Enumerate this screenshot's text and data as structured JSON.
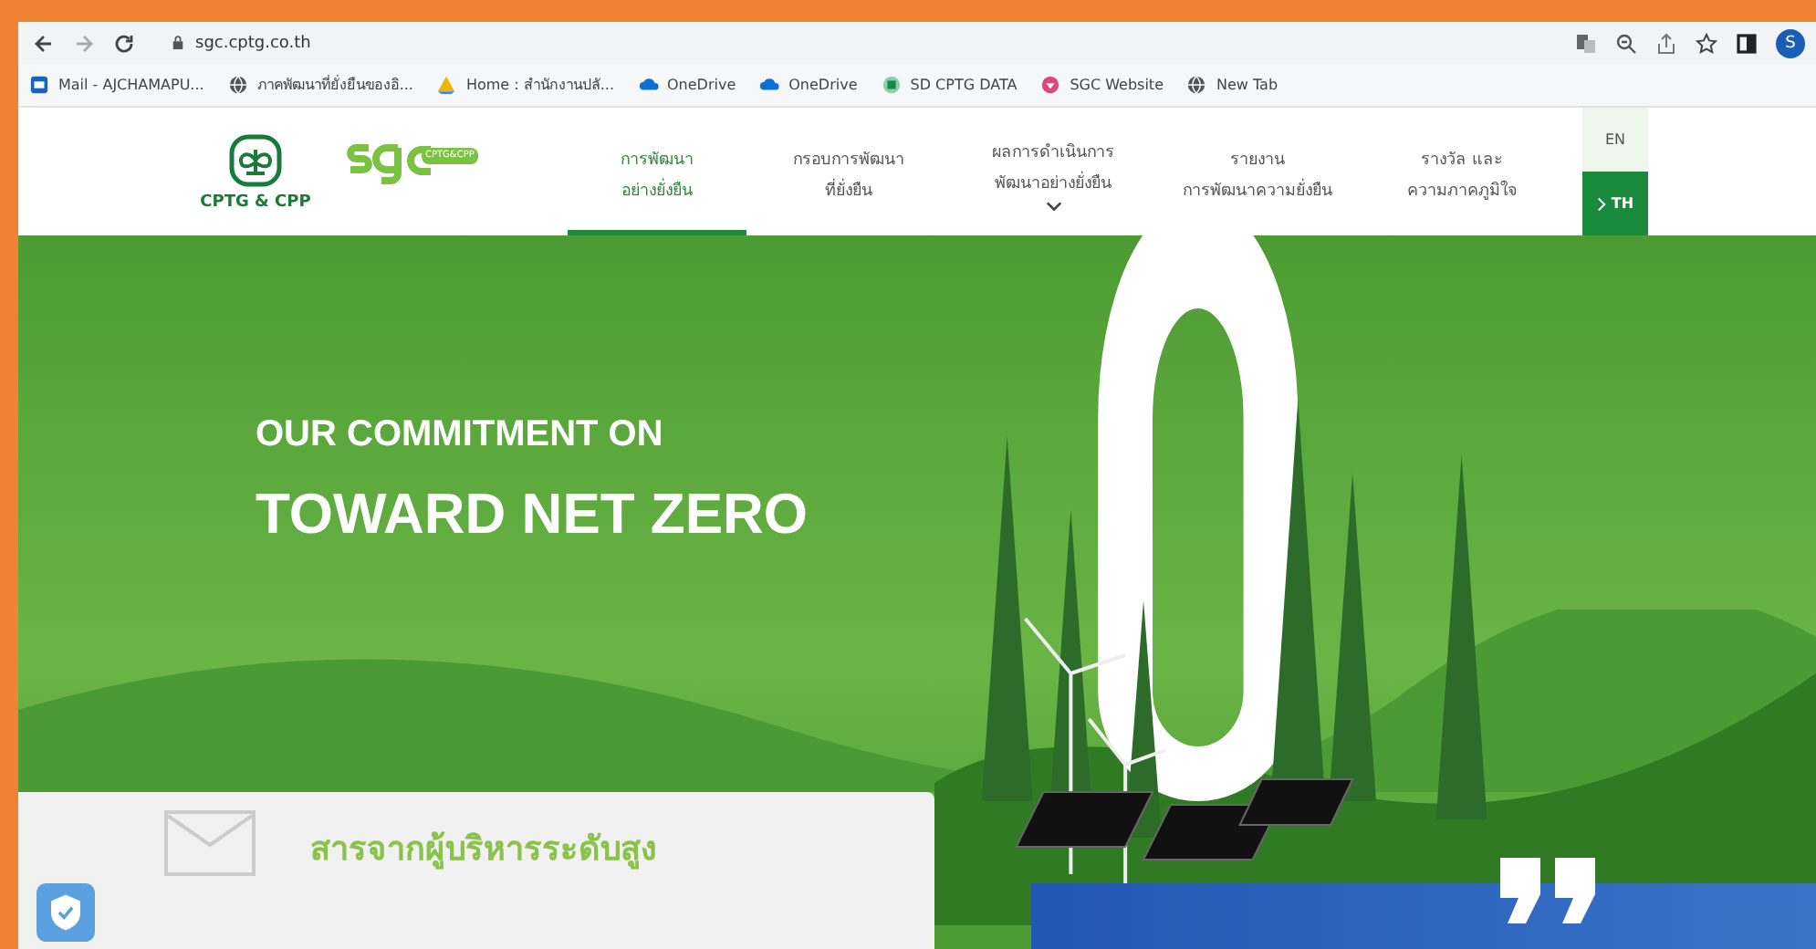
{
  "browser": {
    "url": "sgc.cptg.co.th",
    "avatar": "S",
    "bookmarks": [
      {
        "label": "Mail - AJCHAMAPU...",
        "kind": "mail"
      },
      {
        "label": "ภาคพัฒนาที่ยั่งยืนของอิ...",
        "kind": "globe"
      },
      {
        "label": "Home : สำนักงานปลั...",
        "kind": "drive"
      },
      {
        "label": "OneDrive",
        "kind": "cloud"
      },
      {
        "label": "OneDrive",
        "kind": "cloud"
      },
      {
        "label": "SD CPTG DATA",
        "kind": "sheet"
      },
      {
        "label": "SGC Website",
        "kind": "site"
      },
      {
        "label": "New Tab",
        "kind": "globe"
      }
    ]
  },
  "site": {
    "logo_text": "CPTG & CPP",
    "brand_tag": "CPTG&CPP",
    "nav": [
      {
        "lines": [
          "การพัฒนา",
          "อย่างยั่งยืน"
        ],
        "selected": true,
        "dropdown": false
      },
      {
        "lines": [
          "กรอบการพัฒนา",
          "ที่ยั่งยืน"
        ],
        "selected": false,
        "dropdown": false
      },
      {
        "lines": [
          "ผลการดำเนินการ",
          "พัฒนาอย่างยั่งยืน"
        ],
        "selected": false,
        "dropdown": true
      },
      {
        "lines": [
          "รายงาน",
          "การพัฒนาความยั่งยืน"
        ],
        "selected": false,
        "dropdown": false
      },
      {
        "lines": [
          "รางวัล และ",
          "ความภาคภูมิใจ"
        ],
        "selected": false,
        "dropdown": false
      }
    ],
    "languages": [
      {
        "label": "EN",
        "selected": false
      },
      {
        "label": "TH",
        "selected": true
      }
    ]
  },
  "hero": {
    "line_1": "OUR COMMITMENT ON",
    "line_2": "TOWARD NET ZERO"
  },
  "message_card": {
    "title": "สารจากผู้บริหารระดับสูง"
  }
}
